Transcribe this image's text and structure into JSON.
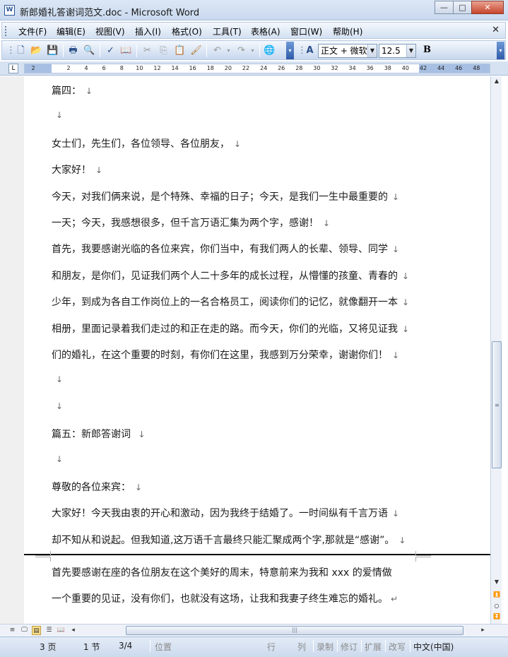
{
  "window": {
    "title": "新郎婚礼答谢词范文.doc - Microsoft Word",
    "app_icon_letter": "W",
    "minimize": "—",
    "maximize": "□",
    "close": "✕"
  },
  "menu": {
    "items": [
      "文件(F)",
      "编辑(E)",
      "视图(V)",
      "插入(I)",
      "格式(O)",
      "工具(T)",
      "表格(A)",
      "窗口(W)",
      "帮助(H)"
    ],
    "doc_close": "✕"
  },
  "toolbar": {
    "style_value": "正文 + 微软",
    "size_value": "12.5",
    "bold_label": "B"
  },
  "ruler": {
    "tab_selector": "L",
    "numbers": [
      "2",
      "2",
      "4",
      "6",
      "8",
      "10",
      "12",
      "14",
      "16",
      "18",
      "20",
      "22",
      "24",
      "26",
      "28",
      "30",
      "32",
      "34",
      "36",
      "38",
      "40",
      "42",
      "44",
      "46",
      "48"
    ]
  },
  "document": {
    "paragraph_mark": "↓",
    "page2_mark": "↵",
    "lines": [
      "篇四：",
      "",
      "女士们，先生们，各位领导、各位朋友，",
      "  大家好！",
      "  今天，对我们俩来说，是个特殊、幸福的日子；今天，是我们一生中最重要的",
      "一天；今天，我感想很多，但千言万语汇集为两个字，感谢！",
      "  首先，我要感谢光临的各位来宾，你们当中，有我们两人的长辈、领导、同学",
      "和朋友，是你们，见证我们两个人二十多年的成长过程，从懵懂的孩童、青春的",
      "少年，到成为各自工作岗位上的一名合格员工，阅读你们的记忆，就像翻开一本",
      "相册，里面记录着我们走过的和正在走的路。而今天，你们的光临，又将见证我",
      "们的婚礼，在这个重要的时刻，有你们在这里，我感到万分荣幸，谢谢你们！",
      "",
      "",
      "篇五：新郎答谢词 ",
      "",
      "尊敬的各位来宾：",
      "  大家好！今天我由衷的开心和激动，因为我终于结婚了。一时间纵有千言万语",
      "却不知从和说起。但我知道,这万语千言最终只能汇聚成两个字,那就是“感谢”。"
    ],
    "page2_lines": [
      "  首先要感谢在座的各位朋友在这个美好的周末，特意前来为我和 xxx 的爱情做",
      "一个重要的见证，没有你们，也就没有这场，让我和我妻子终生难忘的婚礼。"
    ]
  },
  "statusbar": {
    "page": "3 页",
    "section": "1 节",
    "page_of": "3/4",
    "position": "位置",
    "line": "行",
    "column": "列",
    "record": "录制",
    "revise": "修订",
    "extend": "扩展",
    "overtype": "改写",
    "language": "中文(中国)"
  }
}
